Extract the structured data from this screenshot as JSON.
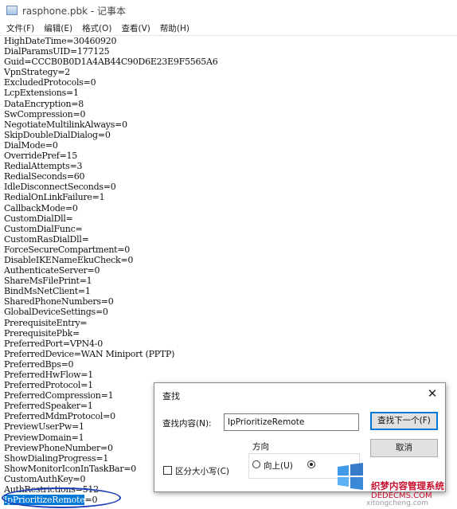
{
  "window": {
    "title": "rasphone.pbk - 记事本"
  },
  "menu": [
    "文件(F)",
    "编辑(E)",
    "格式(O)",
    "查看(V)",
    "帮助(H)"
  ],
  "editor": {
    "lines": [
      "HighDateTime=30460920",
      "DialParamsUID=177125",
      "Guid=CCCB0B0D1A4AB44C90D6E23E9F5565A6",
      "VpnStrategy=2",
      "ExcludedProtocols=0",
      "LcpExtensions=1",
      "DataEncryption=8",
      "SwCompression=0",
      "NegotiateMultilinkAlways=0",
      "SkipDoubleDialDialog=0",
      "DialMode=0",
      "OverridePref=15",
      "RedialAttempts=3",
      "RedialSeconds=60",
      "IdleDisconnectSeconds=0",
      "RedialOnLinkFailure=1",
      "CallbackMode=0",
      "CustomDialDll=",
      "CustomDialFunc=",
      "CustomRasDialDll=",
      "ForceSecureCompartment=0",
      "DisableIKENameEkuCheck=0",
      "AuthenticateServer=0",
      "ShareMsFilePrint=1",
      "BindMsNetClient=1",
      "SharedPhoneNumbers=0",
      "GlobalDeviceSettings=0",
      "PrerequisiteEntry=",
      "PrerequisitePbk=",
      "PreferredPort=VPN4-0",
      "PreferredDevice=WAN Miniport (PPTP)",
      "PreferredBps=0",
      "PreferredHwFlow=1",
      "PreferredProtocol=1",
      "PreferredCompression=1",
      "PreferredSpeaker=1",
      "PreferredMdmProtocol=0",
      "PreviewUserPw=1",
      "PreviewDomain=1",
      "PreviewPhoneNumber=0",
      "ShowDialingProgress=1",
      "ShowMonitorIconInTaskBar=0",
      "CustomAuthKey=0",
      "AuthRestrictions=512"
    ],
    "selected_line": {
      "selected": "IpPrioritizeRemote",
      "rest": "=0"
    }
  },
  "find_dialog": {
    "title": "查找",
    "find_label": "查找内容(N):",
    "find_value": "IpPrioritizeRemote",
    "find_next": "查找下一个(F)",
    "cancel": "取消",
    "direction_label": "方向",
    "up_label": "向上(U)",
    "match_case_label": "区分大小写(C)"
  },
  "watermark": {
    "site_name": "织梦内容管理系统",
    "url": "DEDECMS.COM",
    "bottom": "xitongcheng.com"
  }
}
